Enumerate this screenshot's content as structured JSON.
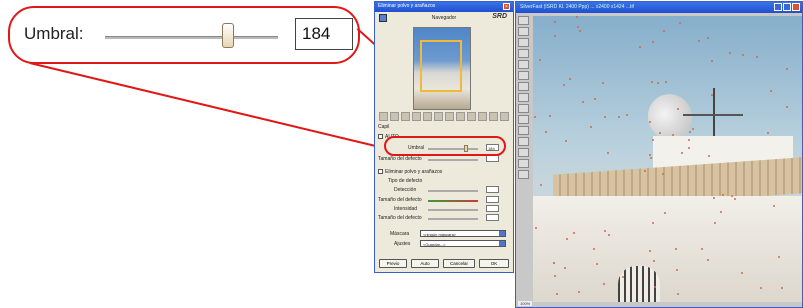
{
  "callout": {
    "label": "Umbral:",
    "value": "184"
  },
  "dialog": {
    "title": "Eliminar polvo y arañazos",
    "nav_label": "Navegador",
    "logo": "SRD",
    "preview_check": "Capil",
    "auto_label": "AUTO",
    "threshold_label": "Umbral",
    "threshold_value": "184",
    "threshold_level": 0.72,
    "size_label": "Tamaño del defecto",
    "scratch_label": "Eliminar polvo y arañazos",
    "defect_type_label": "Tipo de defecto",
    "detection_label": "Detección",
    "defect_size_label": "Tamaño del defecto",
    "intensity_label": "Intensidad",
    "defect_size2_label": "Tamaño del defecto",
    "filter_label": "Máscara",
    "filter_value": "<ningún máscara>",
    "settings_label": "Ajustes",
    "settings_value": "<Guardar...>",
    "buttons": [
      "Previo",
      "Auto",
      "Cancelar",
      "OK"
    ]
  },
  "editor": {
    "title": "SilverFast (ISRD Kl. 2400 Ppp) ... x2400 x1424 ...tif",
    "status": "100%"
  },
  "colors": {
    "accent_red": "#e01818",
    "titlebar_blue": "#1f4fd0"
  }
}
